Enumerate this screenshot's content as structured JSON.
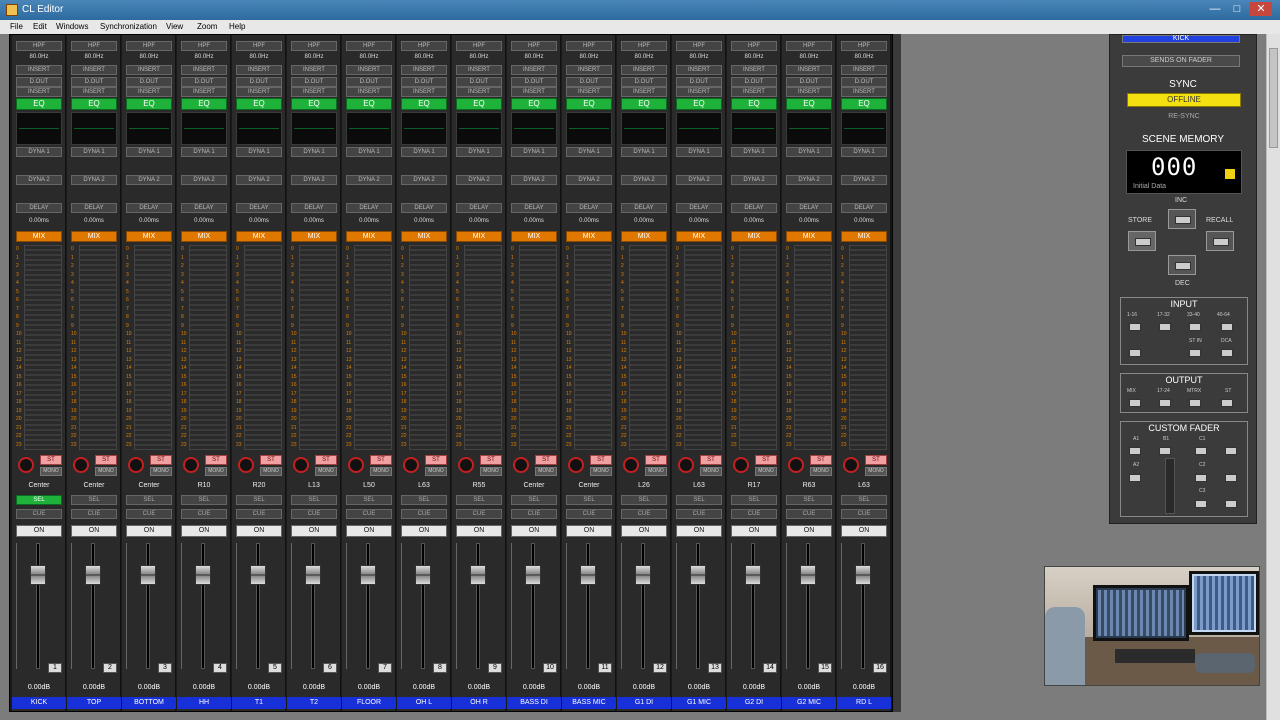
{
  "window": {
    "title": "CL Editor",
    "controls": [
      "—",
      "□",
      "✕"
    ]
  },
  "menu": [
    "File",
    "Edit",
    "Windows",
    "Synchronization",
    "View",
    "Zoom",
    "Help"
  ],
  "strip_common": {
    "hpf": "HPF",
    "hpf_freq": "80.0Hz",
    "insert_a": "INSERT",
    "insert_b": "INSERT",
    "d_out": "D.OUT",
    "eq": "EQ",
    "dyna1": "DYNA 1",
    "dyna1_sub": "",
    "dyna2": "DYNA 2",
    "delay": "DELAY",
    "delay_time": "0.00ms",
    "mix": "MIX",
    "st": "ST",
    "mono": "MONO",
    "sel": "SEL",
    "cue": "CUE",
    "on": "ON",
    "level": "0.00dB",
    "scale": [
      "0",
      "1",
      "2",
      "3",
      "4",
      "5",
      "6",
      "7",
      "8",
      "9",
      "10",
      "11",
      "12",
      "13",
      "14",
      "15",
      "16",
      "17",
      "18",
      "19",
      "20",
      "21",
      "22",
      "23",
      "24"
    ]
  },
  "channels": [
    {
      "num": "1",
      "pan": "Center",
      "name": "KICK",
      "sel_active": true
    },
    {
      "num": "2",
      "pan": "Center",
      "name": "TOP",
      "sel_active": false
    },
    {
      "num": "3",
      "pan": "Center",
      "name": "BOTTOM",
      "sel_active": false
    },
    {
      "num": "4",
      "pan": "R10",
      "name": "HH",
      "sel_active": false
    },
    {
      "num": "5",
      "pan": "R20",
      "name": "T1",
      "sel_active": false
    },
    {
      "num": "6",
      "pan": "L13",
      "name": "T2",
      "sel_active": false
    },
    {
      "num": "7",
      "pan": "L50",
      "name": "FLOOR",
      "sel_active": false
    },
    {
      "num": "8",
      "pan": "L63",
      "name": "OH L",
      "sel_active": false
    },
    {
      "num": "9",
      "pan": "R55",
      "name": "OH R",
      "sel_active": false
    },
    {
      "num": "10",
      "pan": "Center",
      "name": "BASS DI",
      "sel_active": false
    },
    {
      "num": "11",
      "pan": "Center",
      "name": "BASS MIC",
      "sel_active": false
    },
    {
      "num": "12",
      "pan": "L26",
      "name": "G1 DI",
      "sel_active": false
    },
    {
      "num": "13",
      "pan": "L63",
      "name": "G1 MIC",
      "sel_active": false
    },
    {
      "num": "14",
      "pan": "R17",
      "name": "G2 DI",
      "sel_active": false
    },
    {
      "num": "15",
      "pan": "R63",
      "name": "G2 MIC",
      "sel_active": false
    },
    {
      "num": "16",
      "pan": "L63",
      "name": "RD L",
      "sel_active": false
    }
  ],
  "panel": {
    "kick_label": "KICK",
    "sends_on_fader": "SENDS ON FADER",
    "sync": "SYNC",
    "offline": "OFFLINE",
    "resync": "RE-SYNC",
    "scene_memory": "SCENE MEMORY",
    "scene_number": "000",
    "scene_name": "Initial Data",
    "inc": "INC",
    "dec": "DEC",
    "store": "STORE",
    "recall": "RECALL",
    "input": {
      "title": "INPUT",
      "labels": [
        "1-16",
        "17-32",
        "33-40",
        "40-64",
        "ST IN",
        "DCA"
      ]
    },
    "output": {
      "title": "OUTPUT",
      "labels": [
        "MIX",
        "17-24",
        "MTRX",
        "ST"
      ]
    },
    "custom_fader": {
      "title": "CUSTOM FADER",
      "labels": [
        "A1",
        "B1",
        "C1",
        "A2",
        "C2",
        "C3"
      ]
    }
  }
}
